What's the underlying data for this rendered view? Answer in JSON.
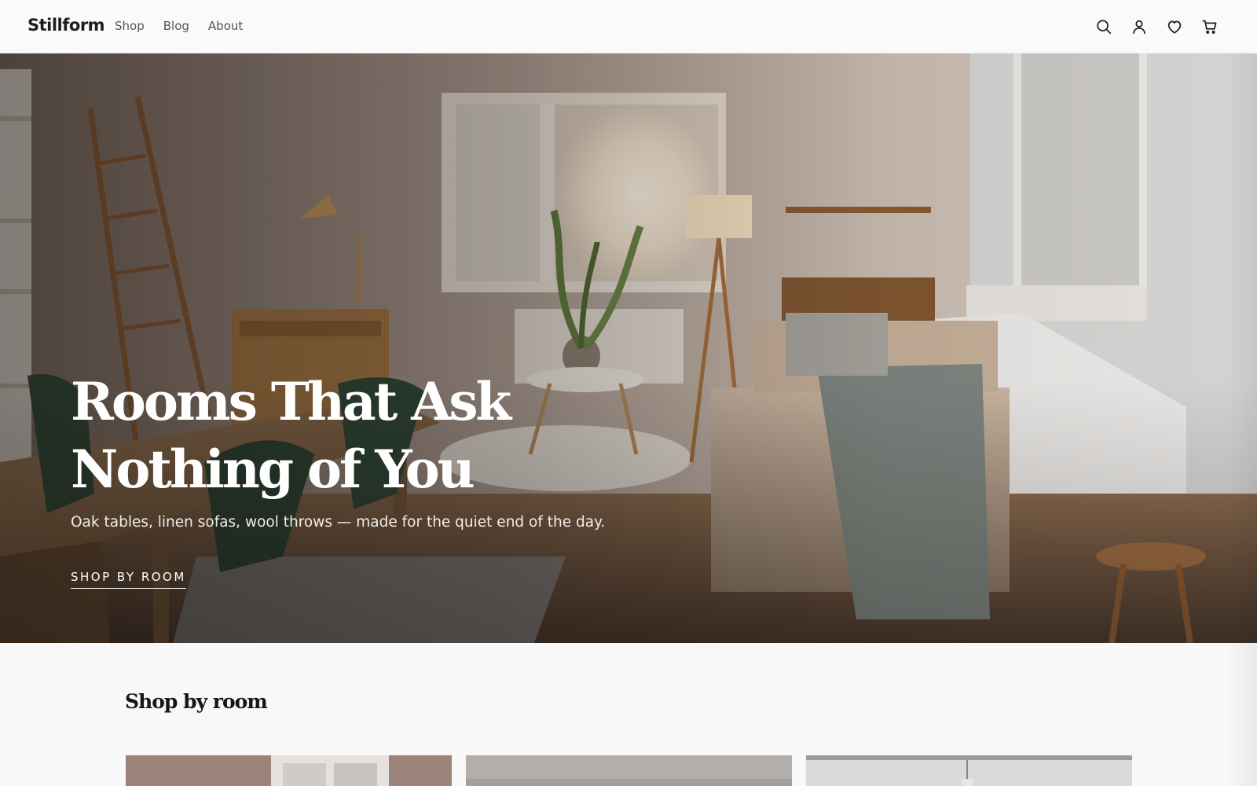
{
  "brand": {
    "name": "Stillform"
  },
  "nav": {
    "items": [
      {
        "label": "Shop"
      },
      {
        "label": "Blog"
      },
      {
        "label": "About"
      }
    ]
  },
  "header_icons": [
    "search-icon",
    "account-icon",
    "wishlist-heart-icon",
    "cart-icon"
  ],
  "hero": {
    "title": "Rooms That Ask Nothing of You",
    "subtitle": "Oak tables, linen sofas, wool throws — made for the quiet end of the day.",
    "cta_label": "SHOP BY ROOM"
  },
  "rooms_section": {
    "title": "Shop by room",
    "card_count_visible": 3
  },
  "colors": {
    "page_bg": "#f8f8f8",
    "header_bg": "#fafafa",
    "text_dark": "#1a1a1a",
    "nav_text": "#555555",
    "hero_text": "#ffffff"
  }
}
